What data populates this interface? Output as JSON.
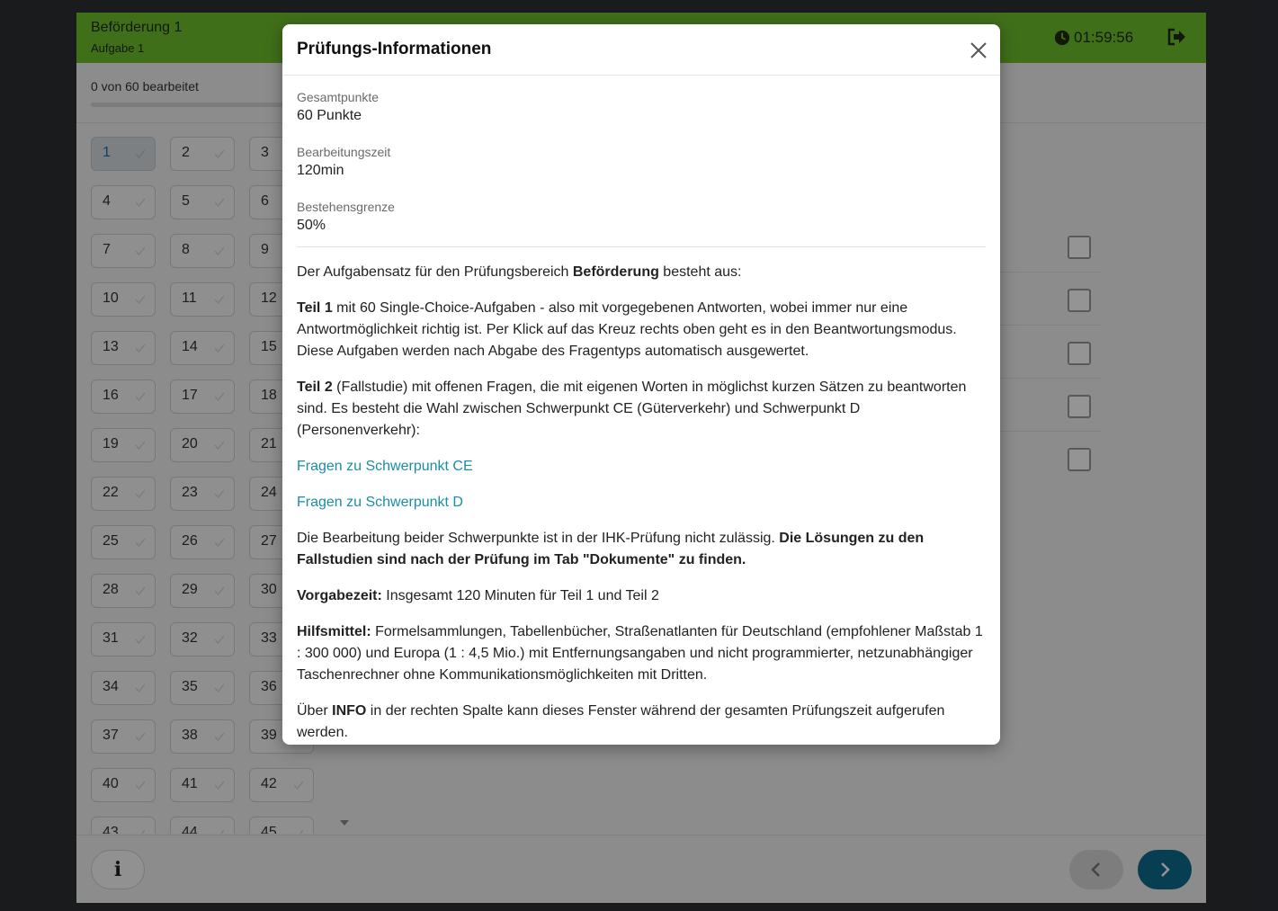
{
  "header": {
    "title": "Beförderung 1",
    "subtitle": "Aufgabe 1",
    "timer": "01:59:56"
  },
  "progress": {
    "text": "0 von 60 bearbeitet",
    "completed": 0,
    "total": 60
  },
  "questions": [
    "1",
    "2",
    "3",
    "4",
    "5",
    "6",
    "7",
    "8",
    "9",
    "10",
    "11",
    "12",
    "13",
    "14",
    "15",
    "16",
    "17",
    "18",
    "19",
    "20",
    "21",
    "22",
    "23",
    "24",
    "25",
    "26",
    "27",
    "28",
    "29",
    "30",
    "31",
    "32",
    "33",
    "34",
    "35",
    "36",
    "37",
    "38",
    "39",
    "40",
    "41",
    "42",
    "43",
    "44",
    "45"
  ],
  "active_question": "1",
  "modal": {
    "title": "Prüfungs-Informationen",
    "fields": [
      {
        "label": "Gesamtpunkte",
        "value": "60 Punkte"
      },
      {
        "label": "Bearbeitungszeit",
        "value": "120min"
      },
      {
        "label": "Bestehensgrenze",
        "value": "50%"
      }
    ],
    "intro": {
      "pre": "Der Aufgabensatz für den Prüfungsbereich ",
      "bold": "Beförderung",
      "post": " besteht aus:"
    },
    "teil1": {
      "bold": "Teil 1",
      "text": " mit 60 Single-Choice-Aufgaben - also mit vorgegebenen Antworten, wobei immer nur eine Antwortmöglichkeit richtig ist. Per Klick auf das Kreuz rechts oben geht es in den Beantwortungsmodus. Diese Aufgaben werden nach Abgabe des Fragentyps automatisch ausgewertet."
    },
    "teil2": {
      "bold": "Teil 2",
      "text": " (Fallstudie) mit offenen Fragen, die mit eigenen Worten in möglichst kurzen Sätzen zu beantworten sind. Es besteht die Wahl zwischen Schwerpunkt CE (Güterverkehr) und Schwerpunkt D (Personenverkehr):"
    },
    "link_ce": "Fragen zu Schwerpunkt CE",
    "link_d": "Fragen zu Schwerpunkt D",
    "bearbeitung": {
      "text": "Die Bearbeitung beider Schwerpunkte ist in der IHK-Prüfung nicht zulässig. ",
      "bold": "Die Lösungen zu den Fallstudien sind nach der Prüfung im Tab \"Dokumente\" zu finden."
    },
    "vorgabezeit": {
      "bold": "Vorgabezeit:",
      "text": " Insgesamt 120 Minuten für Teil 1 und Teil 2"
    },
    "hilfsmittel": {
      "bold": "Hilfsmittel:",
      "text": " Formelsammlungen, Tabellenbücher, Straßenatlanten für Deutschland (empfohlener Maßstab 1 : 300 000) und Europa (1 : 4,5 Mio.) mit Entfernungsangaben und nicht programmierter, netzunabhängiger Taschenrechner ohne Kommunikationsmöglichkeiten mit Dritten."
    },
    "info": {
      "pre": "Über ",
      "bold": "INFO",
      "post": " in der rechten Spalte kann dieses Fenster während der gesamten Prüfungszeit aufgerufen werden."
    }
  },
  "footer": {
    "info_label": "i"
  },
  "colors": {
    "accent_green": "#6fbf2e",
    "primary_teal": "#0e6c8c",
    "link": "#1a8ea5"
  }
}
